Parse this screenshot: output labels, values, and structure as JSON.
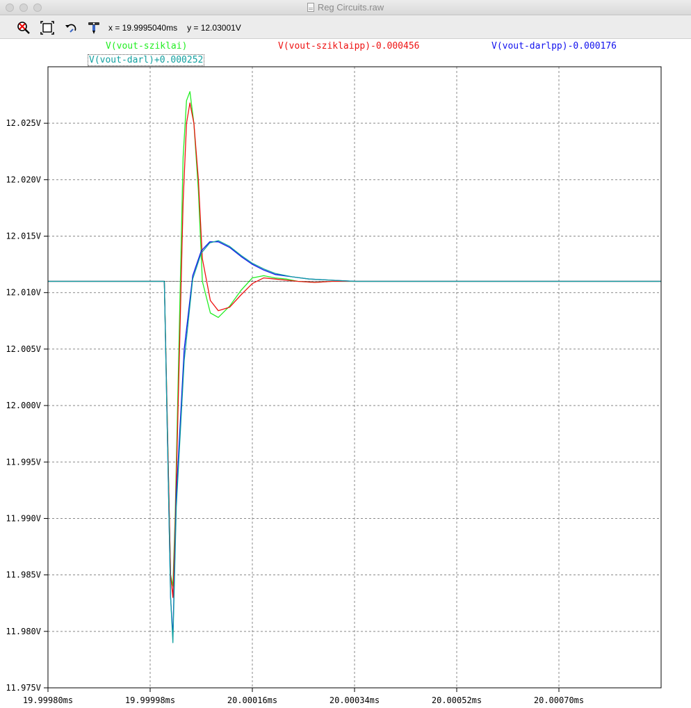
{
  "window": {
    "title": "Reg Circuits.raw"
  },
  "toolbar": {
    "buttons": [
      {
        "name": "zoom-cancel-icon"
      },
      {
        "name": "zoom-full-extents-icon"
      },
      {
        "name": "undo-zoom-icon"
      },
      {
        "name": "probe-icon"
      }
    ],
    "cursor_x": "x = 19.9995040ms",
    "cursor_y": "y = 12.03001V"
  },
  "legend": [
    {
      "label": "V(vout-sziklai)",
      "color": "#22ee22"
    },
    {
      "label": "V(vout-sziklaipp)-0.000456",
      "color": "#ee1111"
    },
    {
      "label": "V(vout-darlpp)-0.000176",
      "color": "#1111ee"
    },
    {
      "label": "V(vout-darl)+0.000252",
      "color": "#11a0a0"
    }
  ],
  "chart_data": {
    "type": "line",
    "xlabel": "",
    "ylabel": "",
    "x_unit": "ms",
    "y_unit": "V",
    "xlim": [
      19.9998,
      20.00088
    ],
    "ylim": [
      11.975,
      12.03
    ],
    "grid": true,
    "x_ticks": [
      "19.99980ms",
      "19.99998ms",
      "20.00016ms",
      "20.00034ms",
      "20.00052ms",
      "20.00070ms"
    ],
    "x_tick_values": [
      19.9998,
      19.99998,
      20.00016,
      20.00034,
      20.00052,
      20.0007
    ],
    "y_ticks": [
      "12.025V",
      "12.020V",
      "12.015V",
      "12.010V",
      "12.005V",
      "12.000V",
      "11.995V",
      "11.990V",
      "11.985V",
      "11.980V",
      "11.975V"
    ],
    "y_tick_values": [
      12.025,
      12.02,
      12.015,
      12.01,
      12.005,
      12.0,
      11.995,
      11.99,
      11.985,
      11.98,
      11.975
    ],
    "reference_line": 12.011,
    "series": [
      {
        "name": "V(vout-sziklai)",
        "color": "#22ee22",
        "x": [
          19.9998,
          20.0,
          20.000005,
          20.000016,
          20.00002,
          20.000024,
          20.000038,
          20.000044,
          20.00005,
          20.000057,
          20.000065,
          20.000072,
          20.000086,
          20.0001,
          20.00012,
          20.00014,
          20.00016,
          20.00018,
          20.0002,
          20.00022,
          20.00024,
          20.00027,
          20.0003,
          20.00035,
          20.00088
        ],
        "y": [
          12.011,
          12.011,
          12.011,
          11.985,
          11.984,
          11.99,
          12.022,
          12.027,
          12.0278,
          12.025,
          12.019,
          12.011,
          12.0082,
          12.0078,
          12.0088,
          12.0102,
          12.0113,
          12.0115,
          12.0113,
          12.0112,
          12.011,
          12.0109,
          12.011,
          12.011,
          12.011
        ]
      },
      {
        "name": "V(vout-sziklaipp)-0.000456",
        "color": "#ee1111",
        "x": [
          19.9998,
          20.0,
          20.000005,
          20.000016,
          20.00002,
          20.000024,
          20.000038,
          20.000044,
          20.00005,
          20.000057,
          20.000065,
          20.000072,
          20.000086,
          20.0001,
          20.00012,
          20.00014,
          20.00016,
          20.00018,
          20.0002,
          20.00022,
          20.00024,
          20.00027,
          20.0003,
          20.00035,
          20.00088
        ],
        "y": [
          12.011,
          12.011,
          12.011,
          11.985,
          11.983,
          11.989,
          12.018,
          12.025,
          12.0268,
          12.025,
          12.02,
          12.013,
          12.0093,
          12.0084,
          12.0087,
          12.0098,
          12.0108,
          12.0113,
          12.0112,
          12.0111,
          12.011,
          12.0109,
          12.011,
          12.011,
          12.011
        ]
      },
      {
        "name": "V(vout-darlpp)-0.000176",
        "color": "#1111ee",
        "x": [
          19.9998,
          20.0,
          20.000005,
          20.000016,
          20.00002,
          20.000026,
          20.00004,
          20.000055,
          20.00007,
          20.000085,
          20.0001,
          20.00012,
          20.00014,
          20.00016,
          20.00018,
          20.0002,
          20.00023,
          20.00026,
          20.0003,
          20.00034,
          20.0004,
          20.0005,
          20.00088
        ],
        "y": [
          12.011,
          12.011,
          12.011,
          11.983,
          11.9795,
          11.992,
          12.005,
          12.0115,
          12.0137,
          12.0145,
          12.0145,
          12.014,
          12.0132,
          12.0125,
          12.012,
          12.0116,
          12.0114,
          12.0112,
          12.0111,
          12.011,
          12.011,
          12.011,
          12.011
        ]
      },
      {
        "name": "V(vout-darl)+0.000252",
        "color": "#11a0a0",
        "x": [
          19.9998,
          20.0,
          20.000005,
          20.000016,
          20.00002,
          20.000026,
          20.00004,
          20.000055,
          20.00007,
          20.000085,
          20.0001,
          20.00012,
          20.00014,
          20.00016,
          20.00018,
          20.0002,
          20.00023,
          20.00026,
          20.0003,
          20.00034,
          20.0004,
          20.0005,
          20.00088
        ],
        "y": [
          12.011,
          12.011,
          12.011,
          11.983,
          11.979,
          11.991,
          12.004,
          12.0112,
          12.0135,
          12.0144,
          12.0146,
          12.0141,
          12.0133,
          12.0126,
          12.0121,
          12.0117,
          12.0114,
          12.0112,
          12.0111,
          12.011,
          12.011,
          12.011,
          12.011
        ]
      }
    ]
  }
}
